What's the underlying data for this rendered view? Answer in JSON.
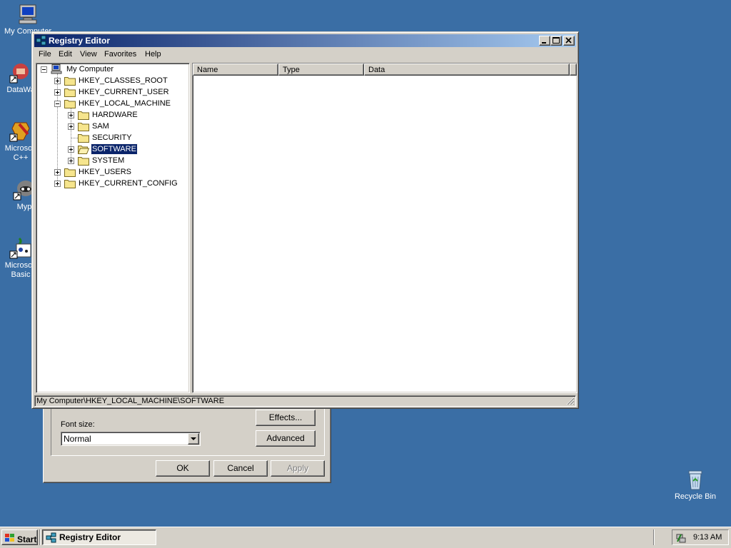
{
  "desktop": {
    "icons": [
      {
        "label": "My Computer",
        "icon": "my-computer-icon"
      },
      {
        "label": "DataWa",
        "icon": "datawa-shortcut-icon"
      },
      {
        "label": "Microsoft",
        "label2": "C++",
        "icon": "visual-cpp-shortcut-icon"
      },
      {
        "label": "Myp",
        "icon": "myp-shortcut-icon"
      },
      {
        "label": "Microsoft",
        "label2": "Basic",
        "icon": "visual-basic-shortcut-icon"
      },
      {
        "label": "Recycle Bin",
        "icon": "recycle-bin-icon"
      }
    ]
  },
  "background_dialog": {
    "effects_button": "Effects...",
    "font_size_label": "Font size:",
    "font_size_value": "Normal",
    "advanced_button": "Advanced",
    "ok_button": "OK",
    "cancel_button": "Cancel",
    "apply_button": "Apply"
  },
  "window": {
    "title": "Registry Editor",
    "menu": [
      "File",
      "Edit",
      "View",
      "Favorites",
      "Help"
    ],
    "tree": {
      "root": "My Computer",
      "nodes": [
        {
          "label": "HKEY_CLASSES_ROOT"
        },
        {
          "label": "HKEY_CURRENT_USER"
        },
        {
          "label": "HKEY_LOCAL_MACHINE"
        },
        {
          "label": "HARDWARE"
        },
        {
          "label": "SAM"
        },
        {
          "label": "SECURITY"
        },
        {
          "label": "SOFTWARE"
        },
        {
          "label": "SYSTEM"
        },
        {
          "label": "HKEY_USERS"
        },
        {
          "label": "HKEY_CURRENT_CONFIG"
        }
      ]
    },
    "list_columns": [
      "Name",
      "Type",
      "Data"
    ],
    "status": "My Computer\\HKEY_LOCAL_MACHINE\\SOFTWARE"
  },
  "taskbar": {
    "start_label": "Start",
    "task_label": "Registry Editor",
    "clock": "9:13 AM"
  },
  "colors": {
    "desktop": "#3a6ea5",
    "face": "#d4d0c8",
    "title_start": "#0a246a",
    "title_end": "#a6caf0",
    "selection": "#0a246a",
    "folder": "#f6e58d"
  }
}
